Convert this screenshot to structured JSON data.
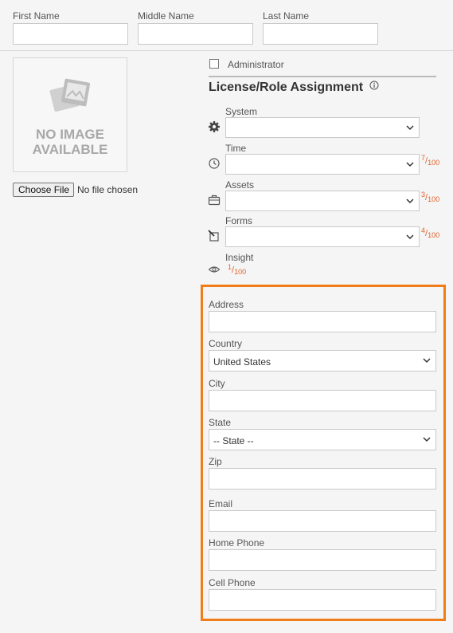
{
  "name": {
    "first_label": "First Name",
    "middle_label": "Middle Name",
    "last_label": "Last Name"
  },
  "photo": {
    "placeholder_line1": "NO IMAGE",
    "placeholder_line2": "AVAILABLE",
    "choose_file_label": "Choose File",
    "file_status": "No file chosen"
  },
  "admin": {
    "label": "Administrator",
    "checked": false
  },
  "licenses": {
    "title": "License/Role Assignment",
    "rows": [
      {
        "label": "System",
        "icon": "gear-icon",
        "value": ""
      },
      {
        "label": "Time",
        "icon": "clock-icon",
        "value": "",
        "used": "7",
        "total": "100"
      },
      {
        "label": "Assets",
        "icon": "briefcase-icon",
        "value": "",
        "used": "3",
        "total": "100"
      },
      {
        "label": "Forms",
        "icon": "form-edit-icon",
        "value": "",
        "used": "4",
        "total": "100"
      },
      {
        "label": "Insight",
        "icon": "eye-icon",
        "used": "1",
        "total": "100"
      }
    ]
  },
  "address": {
    "address_label": "Address",
    "country_label": "Country",
    "country_value": "United States",
    "city_label": "City",
    "state_label": "State",
    "state_value": "-- State --",
    "zip_label": "Zip",
    "email_label": "Email",
    "home_phone_label": "Home Phone",
    "cell_phone_label": "Cell Phone"
  },
  "colors": {
    "highlight": "#f07c1a",
    "quota": "#e0622b"
  }
}
